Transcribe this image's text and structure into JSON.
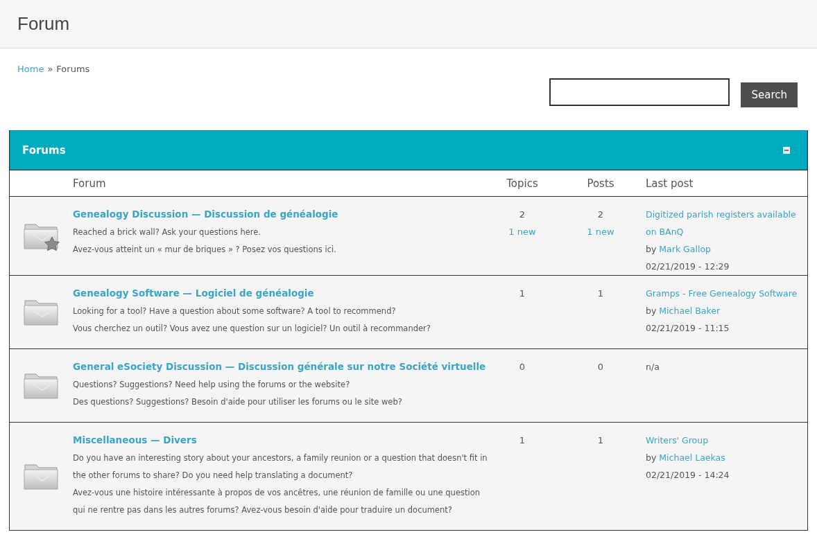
{
  "header": {
    "title": "Forum"
  },
  "breadcrumb": {
    "home": "Home",
    "separator": "»",
    "current": "Forums"
  },
  "search": {
    "button": "Search"
  },
  "panel": {
    "title": "Forums",
    "collapsible": true
  },
  "columns": [
    "Forum",
    "Topics",
    "Posts",
    "Last post"
  ],
  "forums": [
    {
      "has_new": true,
      "title": "Genealogy Discussion — Discussion de généalogie",
      "description": [
        "Reached a brick wall? Ask your questions here.",
        "Avez-vous atteint un « mur de briques » ? Posez vos questions ici."
      ],
      "topics": "2",
      "topics_new": "1 new",
      "posts": "2",
      "posts_new": "1 new",
      "last_post": {
        "kind": "post",
        "title": "Digitized parish registers available on BAnQ",
        "by": "by",
        "author": "Mark Gallop",
        "date": "02/21/2019 - 12:29"
      }
    },
    {
      "has_new": false,
      "title": "Genealogy Software — Logiciel de généalogie",
      "description": [
        "Looking for a tool? Have a question about some software? A tool to recommend?",
        "Vous cherchez un outil? Vous avez une question sur un logiciel? Un outil à recommander?"
      ],
      "topics": "1",
      "posts": "1",
      "last_post": {
        "kind": "post",
        "title": "Gramps - Free Genealogy Software",
        "by": "by",
        "author": "Michael Baker",
        "date": "02/21/2019 - 11:15"
      }
    },
    {
      "has_new": false,
      "title": "General eSociety Discussion — Discussion générale sur notre Société virtuelle",
      "description": [
        "Questions? Suggestions? Need help using the forums or the website?",
        "Des questions? Suggestions? Besoin d'aide pour utiliser les forums ou le site web?"
      ],
      "topics": "0",
      "posts": "0",
      "last_post": {
        "kind": "none",
        "text": "n/a"
      }
    },
    {
      "has_new": false,
      "title": "Miscellaneous — Divers",
      "description": [
        "Do you have an interesting story about your ancestors, a family reunion or a question that doesn't fit in the other forums to share? Do you need help translating a document?",
        "Avez-vous une histoire intéressante à propos de vos ancêtres, une réunion de famille ou une question qui ne rentre pas dans les autres forums? Avez-vous besoin d'aide pour traduire un document?"
      ],
      "topics": "1",
      "posts": "1",
      "last_post": {
        "kind": "post",
        "title": "Writers' Group",
        "by": "by",
        "author": "Michael Laekas",
        "date": "02/21/2019 - 14:24"
      }
    }
  ]
}
